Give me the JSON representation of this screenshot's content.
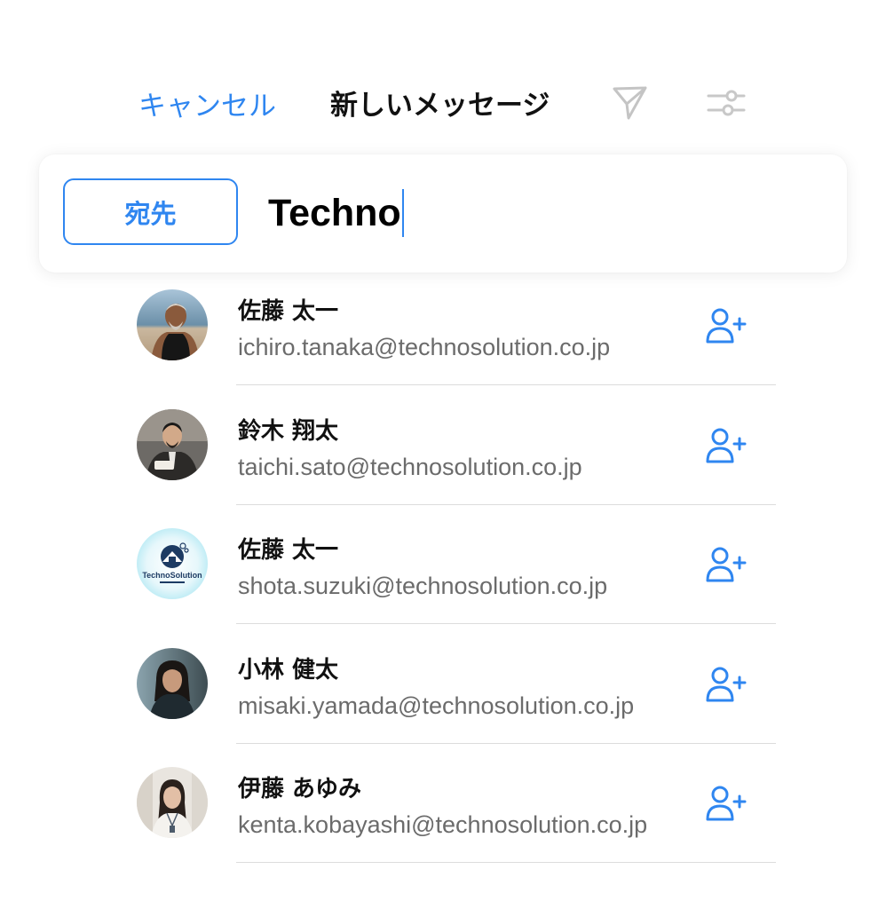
{
  "header": {
    "cancel_label": "キャンセル",
    "title": "新しいメッセージ",
    "send_icon": "paper-plane-icon",
    "filter_icon": "sliders-icon"
  },
  "to_field": {
    "chip_label": "宛先",
    "value": "Techno"
  },
  "colors": {
    "accent": "#2f86f0",
    "text_primary": "#111111",
    "text_secondary": "#6b6b6b",
    "divider": "#dcdcdc"
  },
  "contacts": [
    {
      "name": "佐藤 太一",
      "email": "ichiro.tanaka@technosolution.co.jp",
      "avatar": "photo-man-beach",
      "action_icon": "add-person-icon"
    },
    {
      "name": "鈴木 翔太",
      "email": "taichi.sato@technosolution.co.jp",
      "avatar": "photo-man-suit",
      "action_icon": "add-person-icon"
    },
    {
      "name": "佐藤 太一",
      "email": "shota.suzuki@technosolution.co.jp",
      "avatar": "logo-technosolution",
      "logo_text": "TechnoSolution",
      "action_icon": "add-person-icon"
    },
    {
      "name": "小林 健太",
      "email": "misaki.yamada@technosolution.co.jp",
      "avatar": "photo-woman-seaside",
      "action_icon": "add-person-icon"
    },
    {
      "name": "伊藤 あゆみ",
      "email": "kenta.kobayashi@technosolution.co.jp",
      "avatar": "photo-woman-office",
      "action_icon": "add-person-icon"
    }
  ]
}
